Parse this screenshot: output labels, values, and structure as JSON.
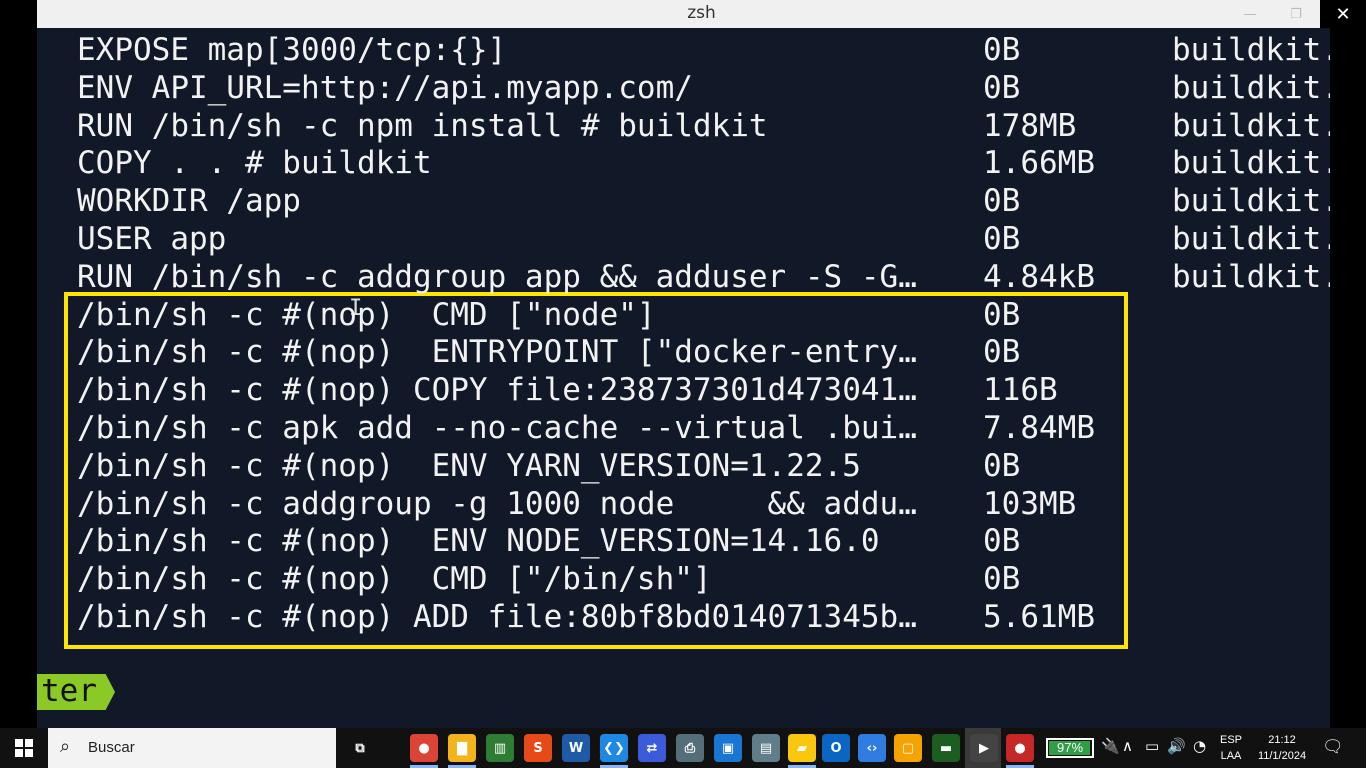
{
  "window": {
    "title": "zsh",
    "minimize_glyph": "—",
    "maximize_glyph": "❐",
    "close_glyph": "✕"
  },
  "terminal": {
    "rows": [
      {
        "cmd": "EXPOSE map[3000/tcp:{}]",
        "size": "0B",
        "comment": "buildkit."
      },
      {
        "cmd": "ENV API_URL=http://api.myapp.com/",
        "size": "0B",
        "comment": "buildkit."
      },
      {
        "cmd": "RUN /bin/sh -c npm install # buildkit",
        "size": "178MB",
        "comment": "buildkit."
      },
      {
        "cmd": "COPY . . # buildkit",
        "size": "1.66MB",
        "comment": "buildkit."
      },
      {
        "cmd": "WORKDIR /app",
        "size": "0B",
        "comment": "buildkit."
      },
      {
        "cmd": "USER app",
        "size": "0B",
        "comment": "buildkit."
      },
      {
        "cmd": "RUN /bin/sh -c addgroup app && adduser -S -G…",
        "size": "4.84kB",
        "comment": "buildkit."
      },
      {
        "cmd": "/bin/sh -c #(nop)  CMD [\"node\"]",
        "size": "0B",
        "comment": ""
      },
      {
        "cmd": "/bin/sh -c #(nop)  ENTRYPOINT [\"docker-entry…",
        "size": "0B",
        "comment": ""
      },
      {
        "cmd": "/bin/sh -c #(nop) COPY file:238737301d473041…",
        "size": "116B",
        "comment": ""
      },
      {
        "cmd": "/bin/sh -c apk add --no-cache --virtual .bui…",
        "size": "7.84MB",
        "comment": ""
      },
      {
        "cmd": "/bin/sh -c #(nop)  ENV YARN_VERSION=1.22.5",
        "size": "0B",
        "comment": ""
      },
      {
        "cmd": "/bin/sh -c addgroup -g 1000 node     && addu…",
        "size": "103MB",
        "comment": ""
      },
      {
        "cmd": "/bin/sh -c #(nop)  ENV NODE_VERSION=14.16.0",
        "size": "0B",
        "comment": ""
      },
      {
        "cmd": "/bin/sh -c #(nop)  CMD [\"/bin/sh\"]",
        "size": "0B",
        "comment": ""
      },
      {
        "cmd": "/bin/sh -c #(nop) ADD file:80bf8bd014071345b…",
        "size": "5.61MB",
        "comment": ""
      }
    ],
    "highlight_color": "#ffe600",
    "prompt_text": "ter",
    "prompt_color": "#8ac926",
    "cursor_glyph": "I"
  },
  "taskbar": {
    "search_placeholder": "Buscar",
    "apps": [
      {
        "name": "task-view-icon",
        "glyph": "⧉",
        "color": "#111111"
      },
      {
        "name": "chrome-icon",
        "glyph": "●",
        "color": "#db4437"
      },
      {
        "name": "file-explorer-icon",
        "glyph": "▇",
        "color": "#f2b418"
      },
      {
        "name": "chart-app-icon",
        "glyph": "▥",
        "color": "#2e7d32"
      },
      {
        "name": "s-app-icon",
        "glyph": "S",
        "color": "#e64a19"
      },
      {
        "name": "word-icon",
        "glyph": "W",
        "color": "#1e5aa8"
      },
      {
        "name": "vscode-icon",
        "glyph": "❮❯",
        "color": "#1e88e5"
      },
      {
        "name": "network-app-icon",
        "glyph": "⇄",
        "color": "#3b5bdb"
      },
      {
        "name": "printer-app-icon",
        "glyph": "⎙",
        "color": "#546e7a"
      },
      {
        "name": "remote-desktop-icon",
        "glyph": "▣",
        "color": "#1976d2"
      },
      {
        "name": "disk-app-icon",
        "glyph": "▤",
        "color": "#607d8b"
      },
      {
        "name": "sticky-notes-icon",
        "glyph": "▰",
        "color": "#f9c80e"
      },
      {
        "name": "outlook-icon",
        "glyph": "O",
        "color": "#0a66c2"
      },
      {
        "name": "code-editor-icon",
        "glyph": "‹›",
        "color": "#2f7de1"
      },
      {
        "name": "box-app-icon",
        "glyph": "▢",
        "color": "#f4a300"
      },
      {
        "name": "terminal-app-icon",
        "glyph": "▬",
        "color": "#1b5e20"
      },
      {
        "name": "media-player-icon",
        "glyph": "▶",
        "color": "#444444"
      },
      {
        "name": "chrome-profile-icon",
        "glyph": "●",
        "color": "#c62828"
      }
    ],
    "battery_percent": "97%",
    "battery_level": 0.97,
    "tray_plug": "🔌",
    "tray_chevron": "∧",
    "tray_battery": "▭",
    "tray_volume": "🔊",
    "tray_wifi": "◔",
    "lang_line1": "ESP",
    "lang_line2": "LAA",
    "time": "21:12",
    "date": "11/1/2024",
    "notif_glyph": "🗨"
  }
}
